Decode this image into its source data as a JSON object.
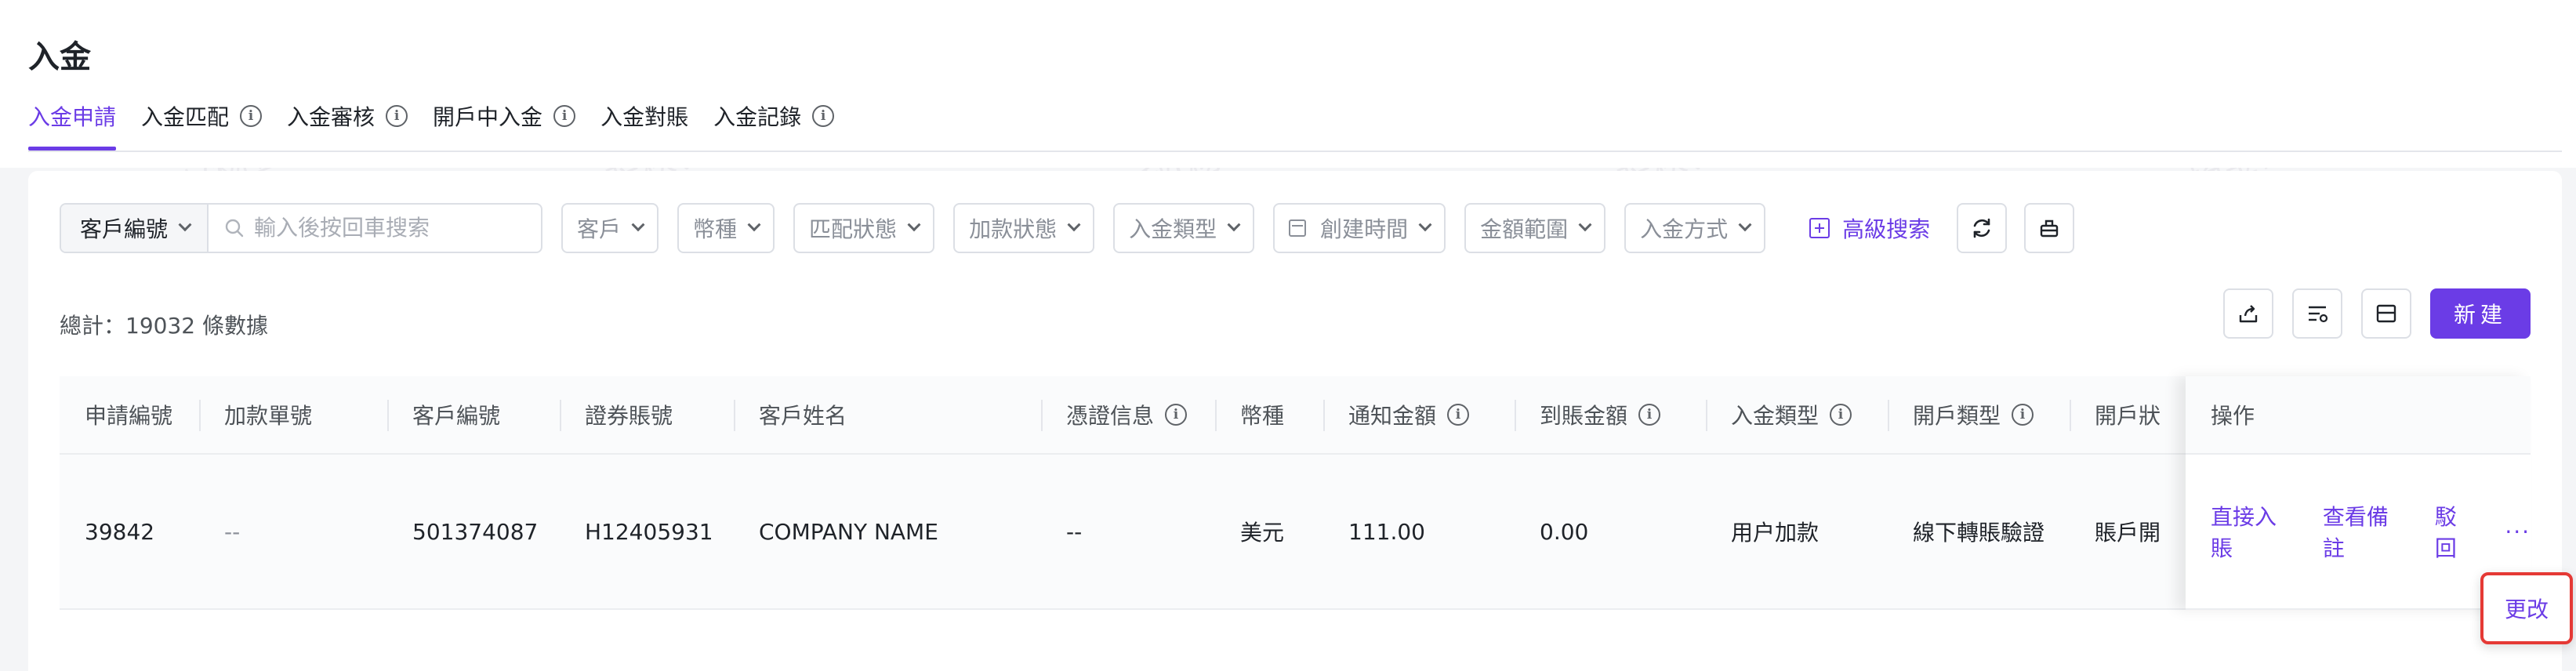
{
  "page": {
    "title": "入金"
  },
  "tabs": [
    {
      "label": "入金申請",
      "active": true,
      "info": false
    },
    {
      "label": "入金匹配",
      "active": false,
      "info": true
    },
    {
      "label": "入金審核",
      "active": false,
      "info": true
    },
    {
      "label": "開戶中入金",
      "active": false,
      "info": true
    },
    {
      "label": "入金對賬",
      "active": false,
      "info": false
    },
    {
      "label": "入金記錄",
      "active": false,
      "info": true
    }
  ],
  "filters": {
    "search_field": "客戶編號",
    "search_placeholder": "輸入後按回車搜索",
    "dropdowns": [
      "客戶",
      "幣種",
      "匹配狀態",
      "加款狀態",
      "入金類型",
      "創建時間",
      "金額範圍",
      "入金方式"
    ],
    "advanced_search": "高級搜索"
  },
  "summary": {
    "total_text": "總計：19032 條數據"
  },
  "buttons": {
    "new": "新建"
  },
  "table": {
    "headers": [
      "申請編號",
      "加款單號",
      "客戶編號",
      "證券賬號",
      "客戶姓名",
      "憑證信息",
      "幣種",
      "通知金額",
      "到賬金額",
      "入金類型",
      "開戶類型",
      "開戶狀"
    ],
    "header_info": [
      false,
      false,
      false,
      false,
      false,
      true,
      false,
      true,
      true,
      true,
      true,
      false
    ],
    "rows": [
      [
        "39842",
        "--",
        "501374087",
        "H12405931",
        "COMPANY NAME",
        "--",
        "美元",
        "111.00",
        "0.00",
        "用户加款",
        "線下轉賬驗證",
        "賬戶開"
      ]
    ],
    "operations": {
      "header": "操作",
      "links": [
        "直接入賬",
        "查看備註",
        "駁回"
      ],
      "more": "···",
      "popup_item": "更改"
    }
  },
  "colors": {
    "accent": "#6b3ce6",
    "highlight_border": "#e53935"
  },
  "watermark": "芳秋(杨金梅) canary"
}
